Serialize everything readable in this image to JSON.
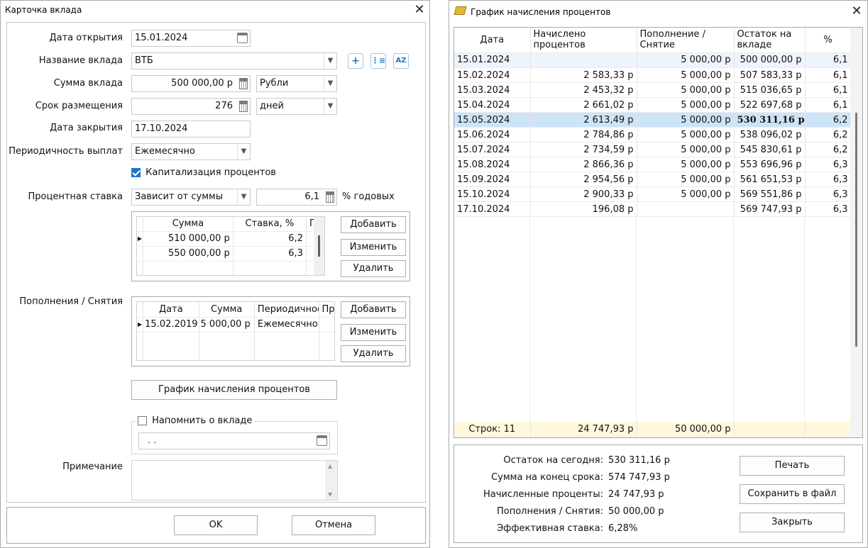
{
  "deposit_card": {
    "title": "Карточка вклада",
    "labels": {
      "open_date": "Дата открытия",
      "name": "Название вклада",
      "amount": "Сумма вклада",
      "term": "Срок размещения",
      "close_date": "Дата закрытия",
      "payout": "Периодичность выплат",
      "capitalization": "Капитализация процентов",
      "rate": "Процентная ставка",
      "rate_suffix": "% годовых",
      "topups": "Пополнения / Снятия",
      "remind": "Напомнить о вкладе",
      "note": "Примечание"
    },
    "values": {
      "open_date": "15.01.2024",
      "name": "ВТБ",
      "amount": "500 000,00 р",
      "currency": "Рубли",
      "term": "276",
      "term_unit": "дней",
      "close_date": "17.10.2024",
      "payout": "Ежемесячно",
      "capitalization_checked": true,
      "rate_type": "Зависит от суммы",
      "rate": "6,1",
      "remind_checked": false,
      "remind_date": ".  .",
      "note": ""
    },
    "rate_table": {
      "headers": [
        "Сумма",
        "Ставка, %",
        "Пр"
      ],
      "rows": [
        [
          "510 000,00 р",
          "6,2"
        ],
        [
          "550 000,00 р",
          "6,3"
        ]
      ]
    },
    "topup_table": {
      "headers": [
        "Дата",
        "Сумма",
        "Периодичнос",
        "Пр"
      ],
      "rows": [
        [
          "15.02.2019",
          "5 000,00 р",
          "Ежемесячно"
        ]
      ]
    },
    "buttons": {
      "add": "Добавить",
      "edit": "Изменить",
      "delete": "Удалить",
      "schedule": "График начисления процентов",
      "ok": "OK",
      "cancel": "Отмена"
    }
  },
  "schedule": {
    "title": "График начисления процентов",
    "headers": [
      "Дата",
      "Начислено процентов",
      "Пополнение / Снятие",
      "Остаток на вкладе",
      "%"
    ],
    "rows": [
      [
        "15.01.2024",
        "",
        "5 000,00 р",
        "500 000,00 р",
        "6,1"
      ],
      [
        "15.02.2024",
        "2 583,33 р",
        "5 000,00 р",
        "507 583,33 р",
        "6,1"
      ],
      [
        "15.03.2024",
        "2 453,32 р",
        "5 000,00 р",
        "515 036,65 р",
        "6,1"
      ],
      [
        "15.04.2024",
        "2 661,02 р",
        "5 000,00 р",
        "522 697,68 р",
        "6,1"
      ],
      [
        "15.05.2024",
        "2 613,49 р",
        "5 000,00 р",
        "530 311,16 р",
        "6,2"
      ],
      [
        "15.06.2024",
        "2 784,86 р",
        "5 000,00 р",
        "538 096,02 р",
        "6,2"
      ],
      [
        "15.07.2024",
        "2 734,59 р",
        "5 000,00 р",
        "545 830,61 р",
        "6,2"
      ],
      [
        "15.08.2024",
        "2 866,36 р",
        "5 000,00 р",
        "553 696,96 р",
        "6,3"
      ],
      [
        "15.09.2024",
        "2 954,56 р",
        "5 000,00 р",
        "561 651,53 р",
        "6,3"
      ],
      [
        "15.10.2024",
        "2 900,33 р",
        "5 000,00 р",
        "569 551,86 р",
        "6,3"
      ],
      [
        "17.10.2024",
        "196,08 р",
        "",
        "569 747,93 р",
        "6,3"
      ]
    ],
    "footer": [
      "Строк: 11",
      "24 747,93 р",
      "50 000,00 р",
      "",
      ""
    ],
    "summary": [
      {
        "label": "Остаток на сегодня:",
        "value": "530 311,16 р"
      },
      {
        "label": "Сумма на конец срока:",
        "value": "574 747,93 р"
      },
      {
        "label": "Начисленные проценты:",
        "value": "24 747,93 р"
      },
      {
        "label": "Пополнения / Снятия:",
        "value": "50 000,00 р"
      },
      {
        "label": "Эффективная ставка:",
        "value": "6,28%"
      }
    ],
    "buttons": {
      "print": "Печать",
      "save": "Сохранить в файл",
      "close": "Закрыть"
    }
  }
}
